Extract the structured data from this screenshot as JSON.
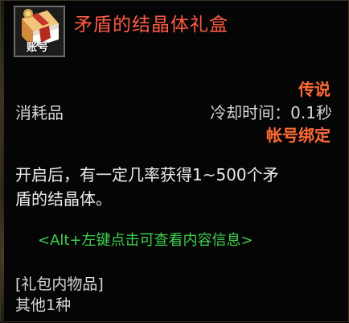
{
  "item": {
    "name": "矛盾的结晶体礼盒",
    "icon": "gift-box-icon",
    "icon_tag": "账号",
    "rarity": "传说",
    "category": "消耗品",
    "cooldown": "冷却时间：0.1秒",
    "binding": "帐号绑定",
    "description_lines": [
      "开启后，有一定几率获得1~500个矛",
      "盾的结晶体。"
    ],
    "hint": "<Alt+左键点击可查看内容信息>",
    "contents_header": "[礼包内物品]",
    "contents_summary": "其他1种"
  },
  "colors": {
    "name": "#ff5a43",
    "rarity": "#ff6a36",
    "hint": "#3fd04f",
    "text": "#d8d8d8",
    "background": "#050505"
  }
}
